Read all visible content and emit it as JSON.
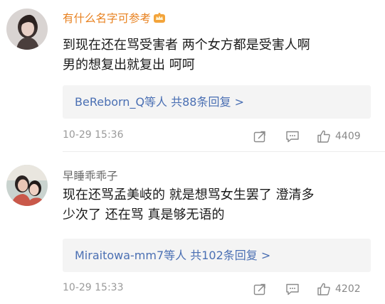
{
  "comments": [
    {
      "username": "有什么名字可参考",
      "content": "到现在还在骂受害者 两个女方都是受害人啊\n男的想复出就复出 呵呵",
      "replies": "BeReborn_Q等人 共88条回复 >",
      "timestamp": "10-29 15:36",
      "likes": "4409"
    },
    {
      "username": "早睡乖乖子",
      "content": "现在还骂孟美岐的 就是想骂女生罢了 澄清多\n少次了 还在骂 真是够无语的",
      "replies": "Miraitowa-mm7等人 共102条回复 >",
      "timestamp": "10-29 15:33",
      "likes": "4202"
    }
  ],
  "icons": {
    "vip": "crown-badge-icon",
    "repost": "repost-icon",
    "comment": "comment-icon",
    "like": "thumbs-up-icon"
  },
  "colors": {
    "vip_name": "#e8811f",
    "normal_name": "#666666",
    "link": "#4a6fb3",
    "meta": "#9a9a9a",
    "reply_bg": "#f4f4f4"
  }
}
